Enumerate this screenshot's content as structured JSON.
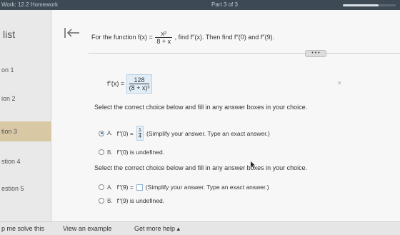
{
  "topbar": {
    "title": "Work: 12.2 Homework",
    "part": "Part 3 of 3",
    "progress": 0.68
  },
  "sidebar": {
    "title": "list",
    "items": [
      {
        "label": "on 1"
      },
      {
        "label": "ion 2"
      },
      {
        "label": "tion 3"
      },
      {
        "label": "stion 4"
      },
      {
        "label": "estion 5"
      }
    ]
  },
  "question": {
    "prefix": "For the function f(x) =",
    "func_num": "x²",
    "func_den": "8 + x",
    "suffix": ", find f′′(x). Then find f′′(0) and f′′(9).",
    "more_label": "• • •",
    "formula_lhs": "f′′(x) =",
    "formula_num": "128",
    "formula_den": "(8 + x)³",
    "corner_mark": "✕"
  },
  "part1": {
    "instruction": "Select the correct choice below and fill in any answer boxes in your choice.",
    "a_letter": "A.",
    "a_lhs": "f′′(0) =",
    "a_num": "1",
    "a_den": "4",
    "a_note": "(Simplify your answer. Type an exact answer.)",
    "b_letter": "B.",
    "b_text": "f′′(0) is undefined."
  },
  "part2": {
    "instruction": "Select the correct choice below and fill in any answer boxes in your choice.",
    "a_letter": "A.",
    "a_lhs": "f′′(9) =",
    "a_note": "(Simplify your answer. Type an exact answer.)",
    "b_letter": "B.",
    "b_text": "f′′(9) is undefined."
  },
  "bottombar": {
    "help_solve": "p me solve this",
    "view_example": "View an example",
    "get_more_help": "Get more help ▴"
  }
}
